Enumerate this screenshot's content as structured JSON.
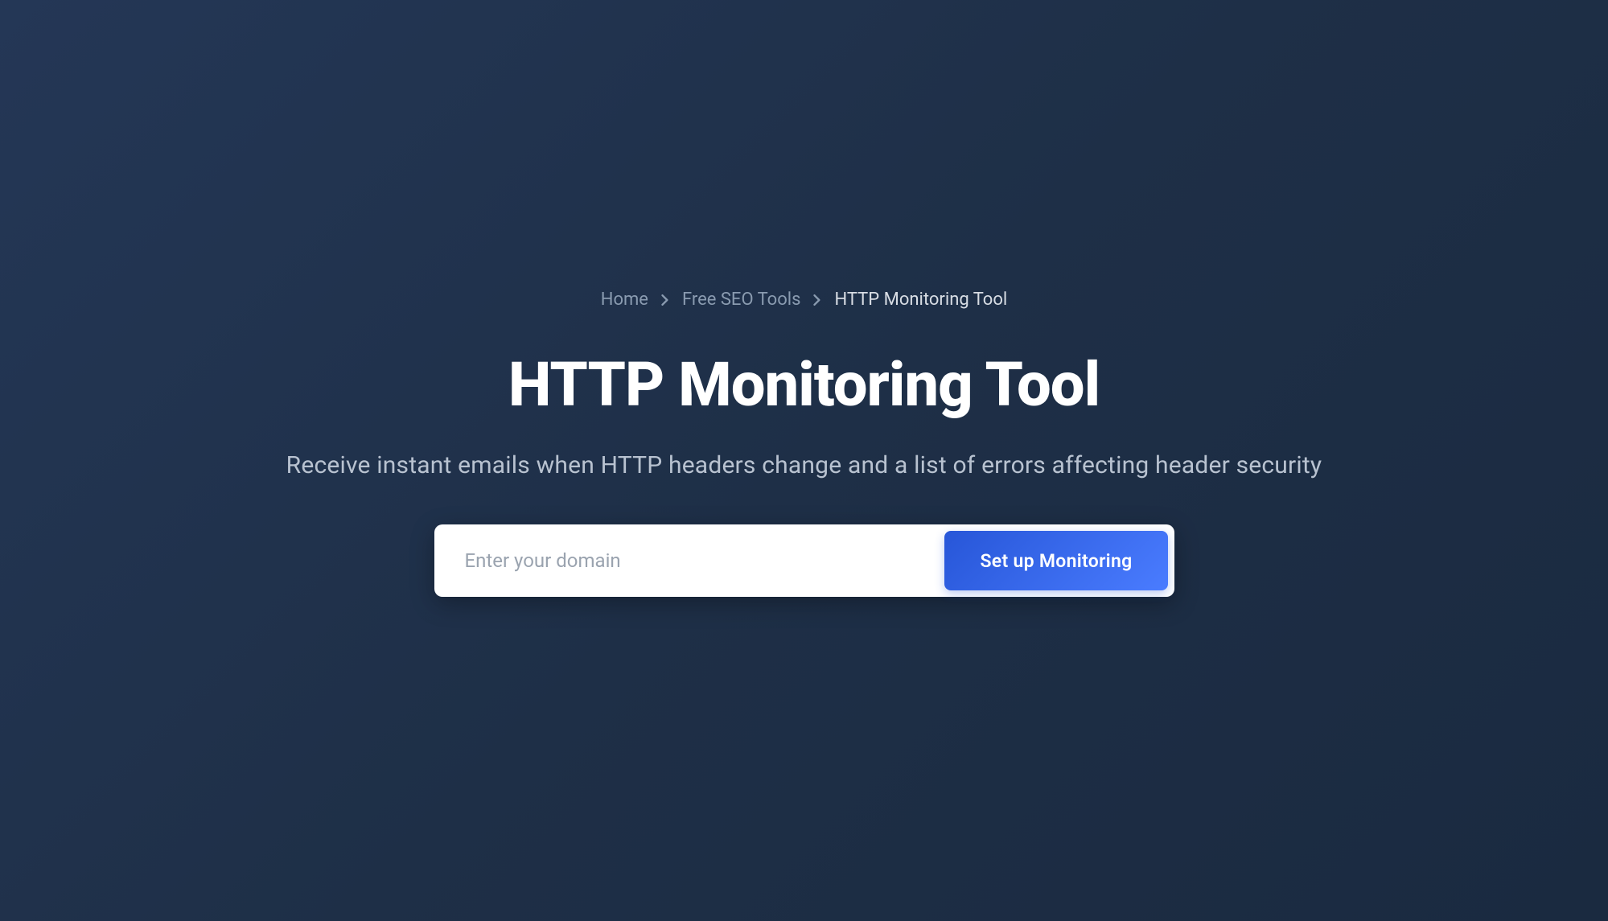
{
  "breadcrumb": {
    "items": [
      {
        "label": "Home",
        "is_current": false
      },
      {
        "label": "Free SEO Tools",
        "is_current": false
      },
      {
        "label": "HTTP Monitoring Tool",
        "is_current": true
      }
    ]
  },
  "hero": {
    "title": "HTTP Monitoring Tool",
    "subtitle": "Receive instant emails when HTTP headers change and a list of errors affecting header security"
  },
  "form": {
    "domain_placeholder": "Enter your domain",
    "submit_label": "Set up Monitoring"
  }
}
